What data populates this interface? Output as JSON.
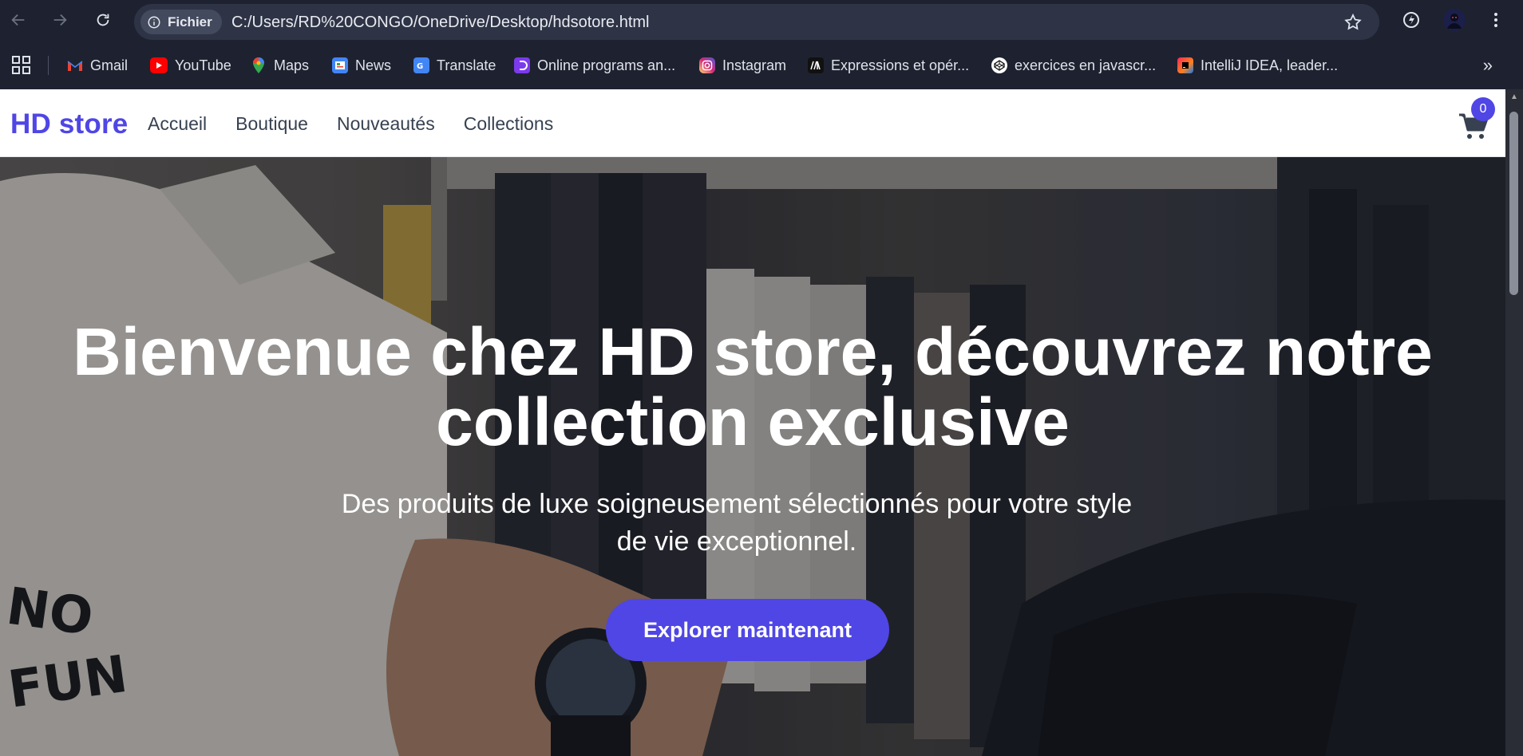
{
  "browser": {
    "site_chip": "Fichier",
    "url": "C:/Users/RD%20CONGO/OneDrive/Desktop/hdsotore.html"
  },
  "bookmarks": [
    {
      "label": "Gmail",
      "icon": "gmail-icon",
      "color": "#ea4335"
    },
    {
      "label": "YouTube",
      "icon": "youtube-icon",
      "color": "#ff0000"
    },
    {
      "label": "Maps",
      "icon": "maps-icon",
      "color": "#34a853"
    },
    {
      "label": "News",
      "icon": "news-icon",
      "color": "#4285f4"
    },
    {
      "label": "Translate",
      "icon": "translate-icon",
      "color": "#4285f4"
    },
    {
      "label": "Online programs an...",
      "icon": "online-programs-icon",
      "color": "#7c3aed"
    },
    {
      "label": "Instagram",
      "icon": "instagram-icon",
      "color": "#e1306c"
    },
    {
      "label": "Expressions et opér...",
      "icon": "expressions-icon",
      "color": "#111111"
    },
    {
      "label": "exercices en  javascr...",
      "icon": "codepen-icon",
      "color": "#ffffff"
    },
    {
      "label": "IntelliJ IDEA, leader...",
      "icon": "intellij-icon",
      "color": "#fe2857"
    }
  ],
  "site": {
    "logo": "HD store",
    "nav": [
      "Accueil",
      "Boutique",
      "Nouveautés",
      "Collections"
    ],
    "cart_count": "0",
    "accent": "#4f46e5"
  },
  "hero": {
    "title": "Bienvenue chez HD store, découvrez notre collection exclusive",
    "subtitle": "Des produits de luxe soigneusement sélectionnés pour votre style de vie exceptionnel.",
    "cta": "Explorer maintenant",
    "shirt_print": "NO FUN"
  }
}
